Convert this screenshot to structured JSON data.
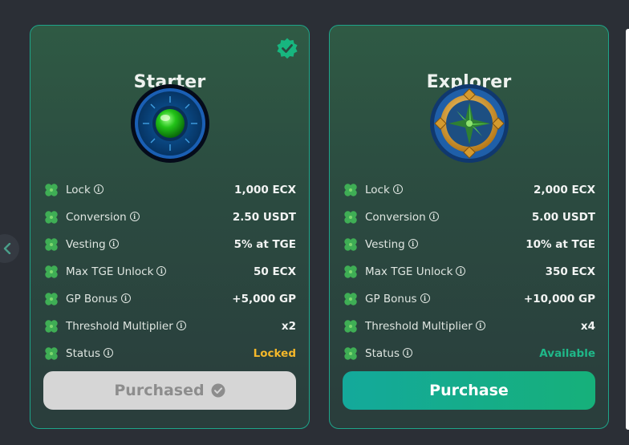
{
  "cards": [
    {
      "title": "Starter",
      "rows": [
        {
          "label": "Lock",
          "value": "1,000 ECX"
        },
        {
          "label": "Conversion",
          "value": "2.50 USDT"
        },
        {
          "label": "Vesting",
          "value": "5% at TGE"
        },
        {
          "label": "Max TGE Unlock",
          "value": "50 ECX"
        },
        {
          "label": "GP Bonus",
          "value": "+5,000 GP"
        },
        {
          "label": "Threshold Multiplier",
          "value": "x2"
        },
        {
          "label": "Status",
          "value": "Locked"
        }
      ],
      "button_label": "Purchased"
    },
    {
      "title": "Explorer",
      "rows": [
        {
          "label": "Lock",
          "value": "2,000 ECX"
        },
        {
          "label": "Conversion",
          "value": "5.00 USDT"
        },
        {
          "label": "Vesting",
          "value": "10% at TGE"
        },
        {
          "label": "Max TGE Unlock",
          "value": "350 ECX"
        },
        {
          "label": "GP Bonus",
          "value": "+10,000 GP"
        },
        {
          "label": "Threshold Multiplier",
          "value": "x4"
        },
        {
          "label": "Status",
          "value": "Available"
        }
      ],
      "button_label": "Purchase"
    }
  ],
  "icons": {
    "row_icon": "four-leaf-clover-icon",
    "info_icon": "info-circle-icon",
    "verified_icon": "verified-badge-icon",
    "nav_icon": "chevron-left-icon",
    "info_glyph": "i"
  },
  "colors": {
    "accent": "#1ea58a",
    "status_locked": "#f5b82a",
    "status_available": "#1fb889",
    "purchase_button": "#14a99b"
  }
}
